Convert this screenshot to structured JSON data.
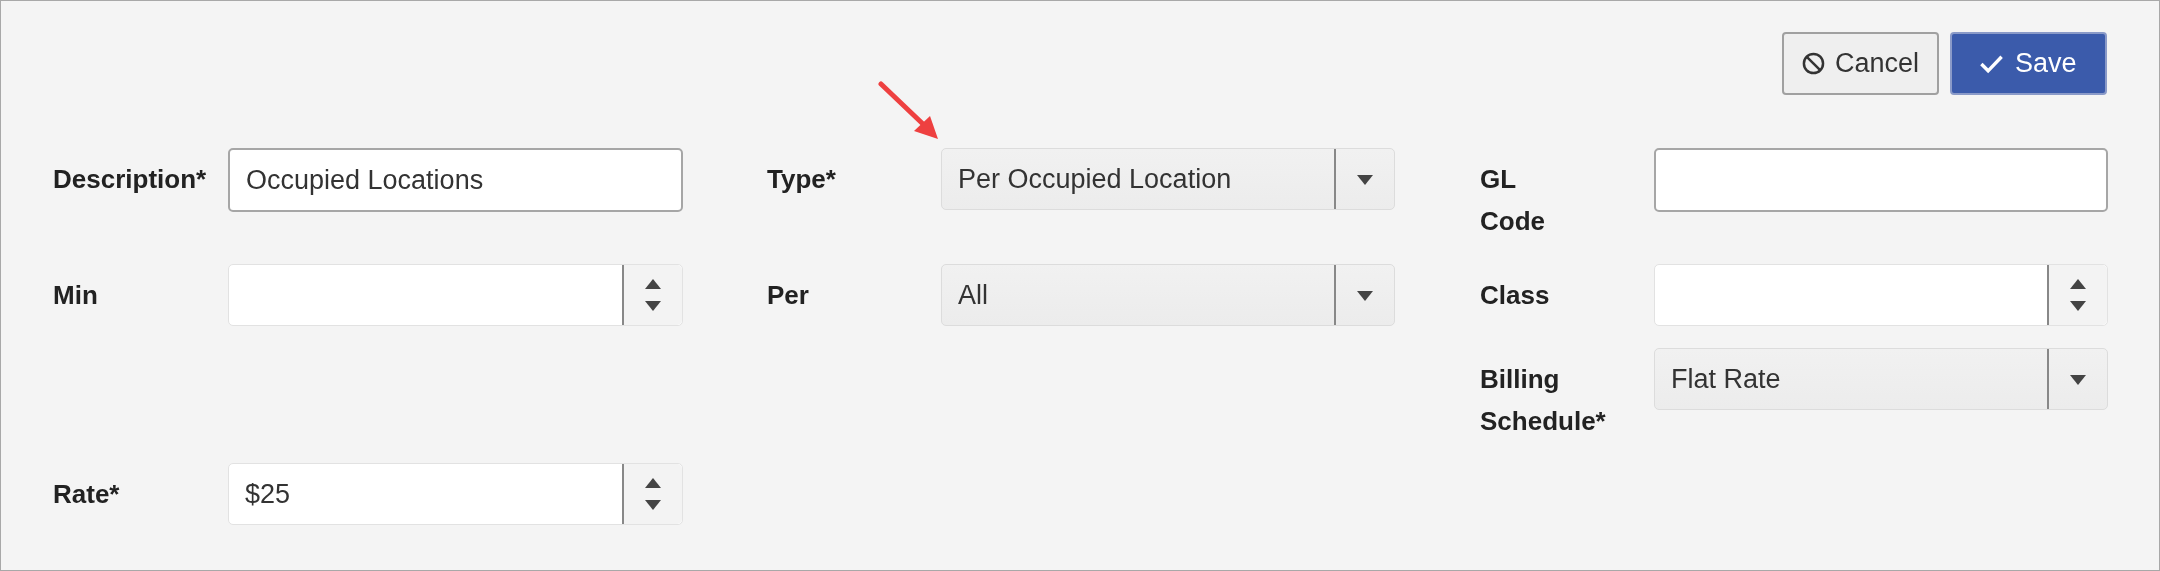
{
  "actions": [
    {
      "kind": "cancel",
      "label": "Cancel"
    },
    {
      "kind": "save",
      "label": "Save"
    }
  ],
  "fields": [
    {
      "label": "Description*",
      "kind": "text",
      "value": "Occupied Locations"
    },
    {
      "label": "Type*",
      "kind": "select",
      "value": "Per Occupied Location"
    },
    {
      "label": "GL Code",
      "kind": "text"
    },
    {
      "label": "Min",
      "kind": "number"
    },
    {
      "label": "Per",
      "kind": "select",
      "value": "All"
    },
    {
      "label": "Class",
      "kind": "number"
    },
    {
      "label": "Billing Schedule*",
      "kind": "select",
      "value": "Flat Rate"
    },
    {
      "label": "Rate*",
      "kind": "number",
      "value": "$25"
    }
  ]
}
